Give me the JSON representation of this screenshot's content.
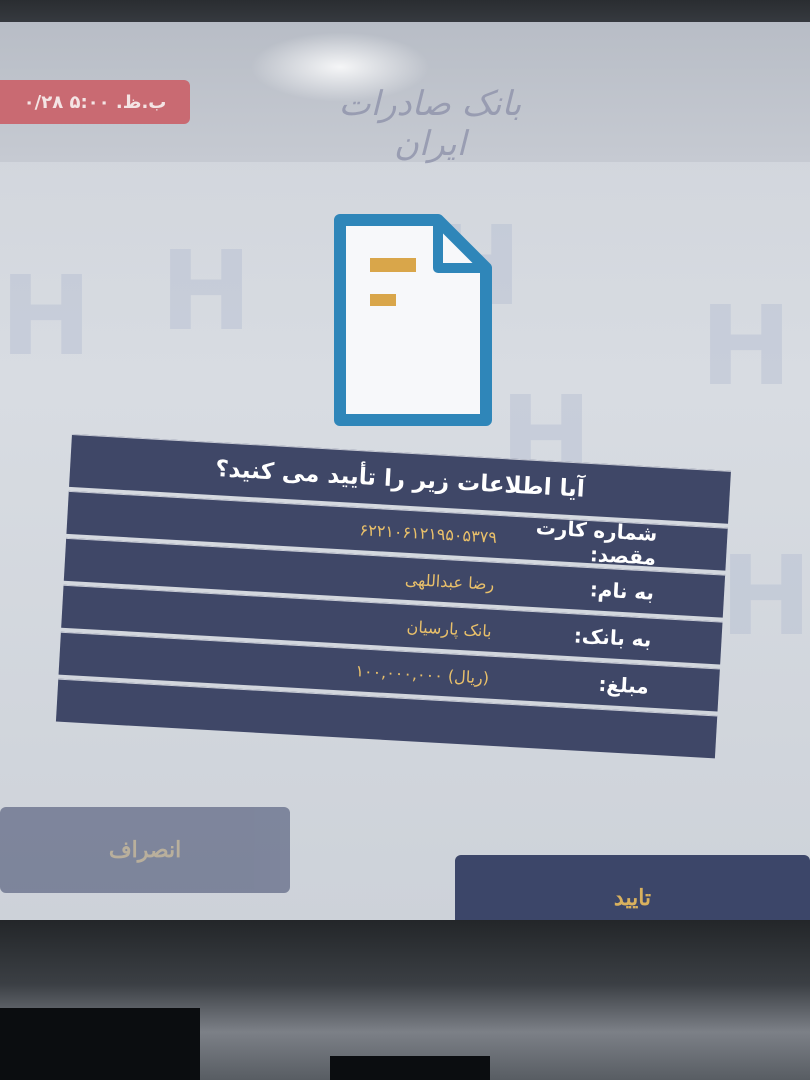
{
  "header": {
    "datetime": "ب.ظ. ۵:۰۰ ۰/۲۸",
    "bank_name": "بانک صادرات ایران"
  },
  "icons": {
    "document": "document-icon",
    "watermark": "bank-logo-watermark"
  },
  "dialog": {
    "question": "آیا اطلاعات زیر را تأیید می کنید؟",
    "rows": [
      {
        "label": "شماره کارت مقصد:",
        "value": "۶۲۲۱۰۶۱۲۱۹۵۰۵۳۷۹"
      },
      {
        "label": "به نام:",
        "value": "رضا عبداللهی"
      },
      {
        "label": "به بانک:",
        "value": "بانک پارسیان"
      },
      {
        "label": "مبلغ:",
        "value": "(ریال) ۱۰۰,۰۰۰,۰۰۰"
      }
    ]
  },
  "buttons": {
    "cancel": "انصراف",
    "confirm": "تایید"
  },
  "colors": {
    "panel": "#3f4767",
    "value_text": "#e9c06a",
    "button_text": "#d9b15e",
    "datetime_badge": "#c96a72"
  }
}
